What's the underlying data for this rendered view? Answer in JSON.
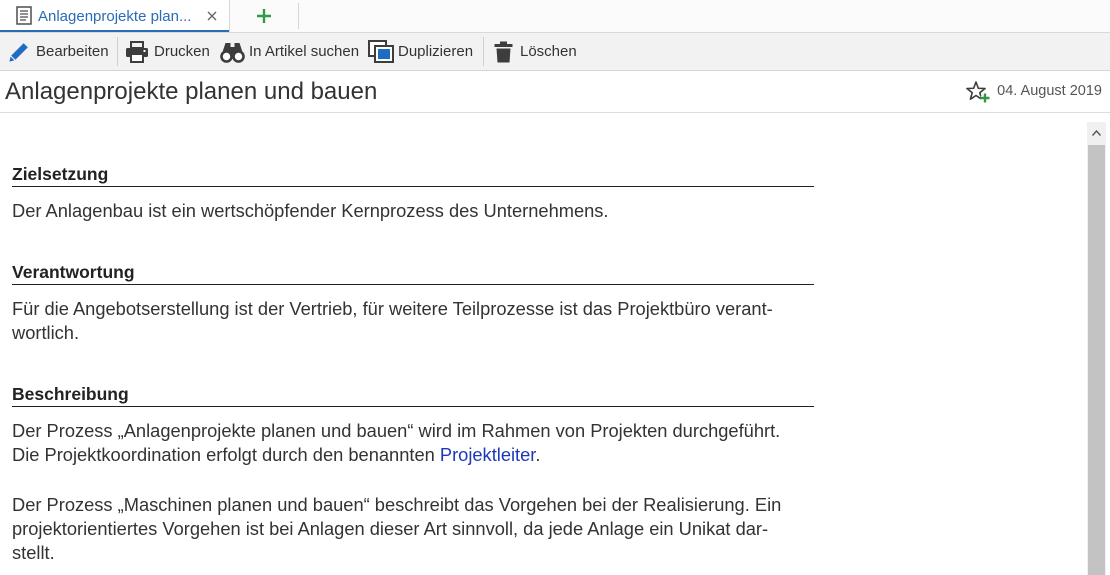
{
  "colors": {
    "accent": "#2a6cb5",
    "link": "#1c38b8",
    "add": "#2f9a45",
    "edit": "#1e6cc6"
  },
  "tabs": [
    {
      "label": "Anlagenprojekte plan...",
      "icon": "document-icon",
      "close_icon": "close-icon"
    }
  ],
  "new_tab": {
    "icon": "plus-icon"
  },
  "toolbar": {
    "items": [
      {
        "label": "Bearbeiten",
        "icon": "pencil-icon"
      },
      {
        "label": "Drucken",
        "icon": "printer-icon"
      },
      {
        "label": "In Artikel suchen",
        "icon": "binoculars-icon"
      },
      {
        "label": "Duplizieren",
        "icon": "duplicate-icon"
      },
      {
        "label": "Löschen",
        "icon": "trash-icon"
      }
    ]
  },
  "article": {
    "title": "Anlagenprojekte planen und bauen",
    "favorite_icon": "star-plus-icon",
    "date": "04. August 2019",
    "sections": [
      {
        "heading": "Zielsetzung",
        "paragraphs": [
          {
            "lines": [
              {
                "text": "Der Anlagenbau ist ein wertschöpfender Kernprozess des Unternehmens."
              }
            ]
          }
        ]
      },
      {
        "heading": "Verantwortung",
        "paragraphs": [
          {
            "lines": [
              {
                "text": "Für die Angebotserstellung ist der Vertrieb, für weitere Teilprozesse ist das Projektbüro verant-"
              },
              {
                "text": "wortlich."
              }
            ]
          }
        ]
      },
      {
        "heading": "Beschreibung",
        "paragraphs": [
          {
            "lines": [
              {
                "text": "Der Prozess „Anlagenprojekte planen und bauen“ wird im Rahmen von Projekten durchgeführt."
              },
              {
                "text": "Die Projektkoordination erfolgt durch den benannten ",
                "link": "Projektleiter",
                "after": "."
              }
            ]
          },
          {
            "lines": [
              {
                "text": "Der Prozess „Maschinen planen und bauen“ beschreibt das Vorgehen bei der Realisierung. Ein"
              },
              {
                "text": "projektorientiertes Vorgehen ist bei Anlagen dieser Art sinnvoll, da jede Anlage ein Unikat dar-"
              },
              {
                "text": "stellt."
              }
            ]
          }
        ]
      }
    ]
  }
}
